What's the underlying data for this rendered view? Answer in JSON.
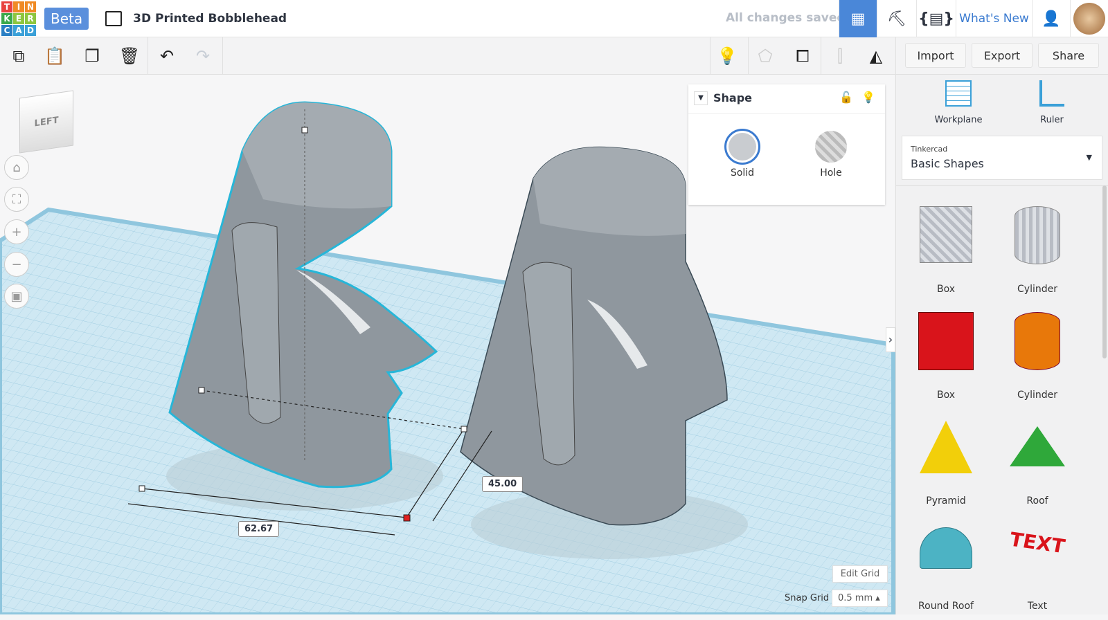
{
  "header": {
    "logo_letters": [
      "T",
      "I",
      "N",
      "K",
      "E",
      "R",
      "C",
      "A",
      "D"
    ],
    "beta": "Beta",
    "title": "3D Printed Bobblehead",
    "status": "All changes saved",
    "whats_new": "What's New"
  },
  "toolbar": {
    "import": "Import",
    "export": "Export",
    "share": "Share"
  },
  "viewcube": {
    "face": "LEFT"
  },
  "shape_panel": {
    "title": "Shape",
    "solid": "Solid",
    "hole": "Hole"
  },
  "dimensions": {
    "width": "62.67",
    "depth": "45.00"
  },
  "grid": {
    "edit": "Edit Grid",
    "snap_label": "Snap Grid",
    "snap_value": "0.5 mm"
  },
  "right_panel": {
    "workplane": "Workplane",
    "ruler": "Ruler",
    "library_source": "Tinkercad",
    "library": "Basic Shapes",
    "shapes": [
      {
        "label": "Box",
        "color": "#c8ccd4"
      },
      {
        "label": "Cylinder",
        "color": "#c8ccd4"
      },
      {
        "label": "Box",
        "color": "#d9141b"
      },
      {
        "label": "Cylinder",
        "color": "#e8780a"
      },
      {
        "label": "Pyramid",
        "color": "#f2cf0a"
      },
      {
        "label": "Roof",
        "color": "#2fa83a"
      },
      {
        "label": "Round Roof",
        "color": "#4cb3c4"
      },
      {
        "label": "Text",
        "color": "#d9141b"
      }
    ]
  }
}
